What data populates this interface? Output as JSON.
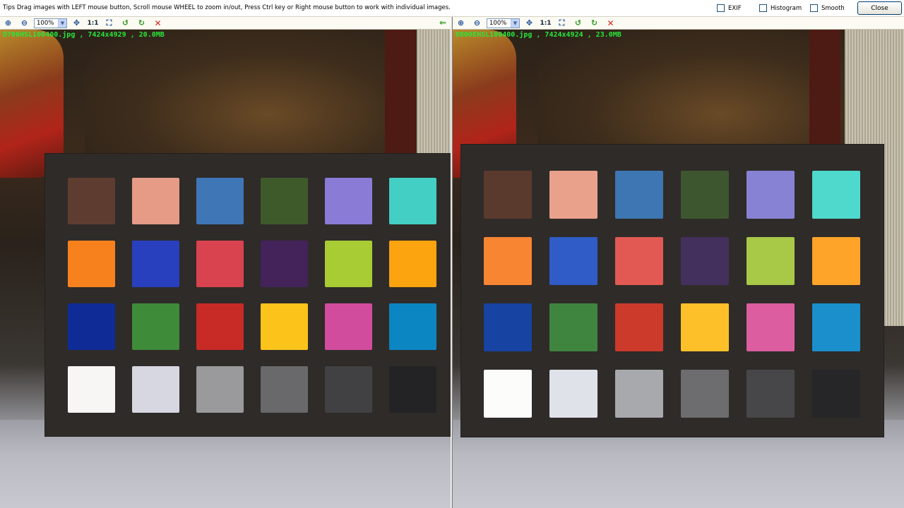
{
  "tips": "Tips  Drag images with LEFT mouse button, Scroll mouse WHEEL to zoom in/out, Press Ctrl key or Right mouse button to work with individual images.",
  "options": [
    {
      "label": "EXIF",
      "checked": false
    },
    {
      "label": "Histogram",
      "checked": false
    },
    {
      "label": "Smooth",
      "checked": false
    }
  ],
  "close_label": "Close",
  "panes": [
    {
      "zoom": "100%",
      "one_to_one": "1:1",
      "file_info": "D700HSL100400.jpg , 7424x4929 , 20.0MB",
      "patches": [
        "#5e3d30",
        "#e69b87",
        "#3f77b6",
        "#3f5a2a",
        "#8a7bd6",
        "#43cfc4",
        "#f7821d",
        "#2840be",
        "#d9434f",
        "#43235a",
        "#a7cc34",
        "#fca310",
        "#0f2c96",
        "#3e8b3a",
        "#c82a26",
        "#fcc31b",
        "#d24c9e",
        "#0b86c2",
        "#f7f6f4",
        "#d6d7e0",
        "#9a9a9d",
        "#69696b",
        "#414143",
        "#232325"
      ]
    },
    {
      "zoom": "100%",
      "one_to_one": "1:1",
      "file_info": "D800EHSL100400.jpg , 7424x4924 , 23.0MB",
      "patches": [
        "#5a3a2c",
        "#eaa18c",
        "#3d76b2",
        "#3d5630",
        "#8882d4",
        "#4fd8cc",
        "#f88532",
        "#2f5cc6",
        "#e25953",
        "#44305c",
        "#a8c848",
        "#fea428",
        "#1743a2",
        "#3f8540",
        "#cc3a2c",
        "#fec028",
        "#dc5ea0",
        "#1a8fcc",
        "#fcfcfa",
        "#e0e2ea",
        "#a8a9ad",
        "#6d6d6f",
        "#474749",
        "#262628"
      ]
    }
  ]
}
